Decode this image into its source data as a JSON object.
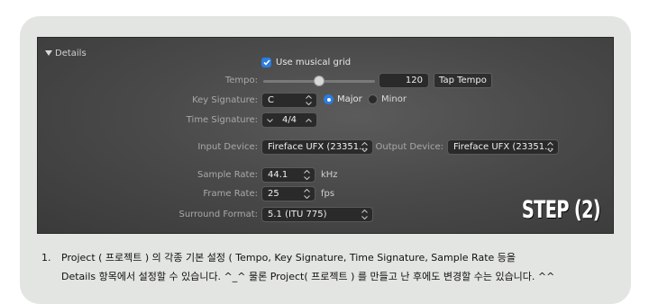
{
  "details": {
    "section_label": "Details",
    "use_musical_grid": "Use musical grid",
    "tempo_label": "Tempo:",
    "tempo_value": "120",
    "tempo_slider_level": 0.5,
    "tap_tempo": "Tap Tempo",
    "key_signature_label": "Key Signature:",
    "key_value": "C",
    "major": "Major",
    "minor": "Minor",
    "time_signature_label": "Time Signature:",
    "time_value": "4/4",
    "input_device_label": "Input Device:",
    "input_device_value": "Fireface UFX (23351...",
    "output_device_label": "Output Device:",
    "output_device_value": "Fireface UFX (23351...",
    "sample_rate_label": "Sample Rate:",
    "sample_rate_value": "44.1",
    "sample_rate_unit": "kHz",
    "frame_rate_label": "Frame Rate:",
    "frame_rate_value": "25",
    "frame_rate_unit": "fps",
    "surround_format_label": "Surround Format:",
    "surround_format_value": "5.1 (ITU 775)"
  },
  "watermark": "STEP (2)",
  "caption": {
    "number": "1.",
    "line1": "Project ( 프로젝트 ) 의 각종 기본 설정 ( Tempo, Key Signature, Time Signature, Sample Rate 등을",
    "line2": "Details 항목에서 설정할 수 있습니다. ^_^ 물론 Project( 프로젝트 ) 를 만들고 난 후에도 변경할 수는 있습니다. ^^"
  },
  "colors": {
    "accent": "#2b7de0",
    "panel": "#4a4a4a",
    "card": "#e3e5e2"
  }
}
